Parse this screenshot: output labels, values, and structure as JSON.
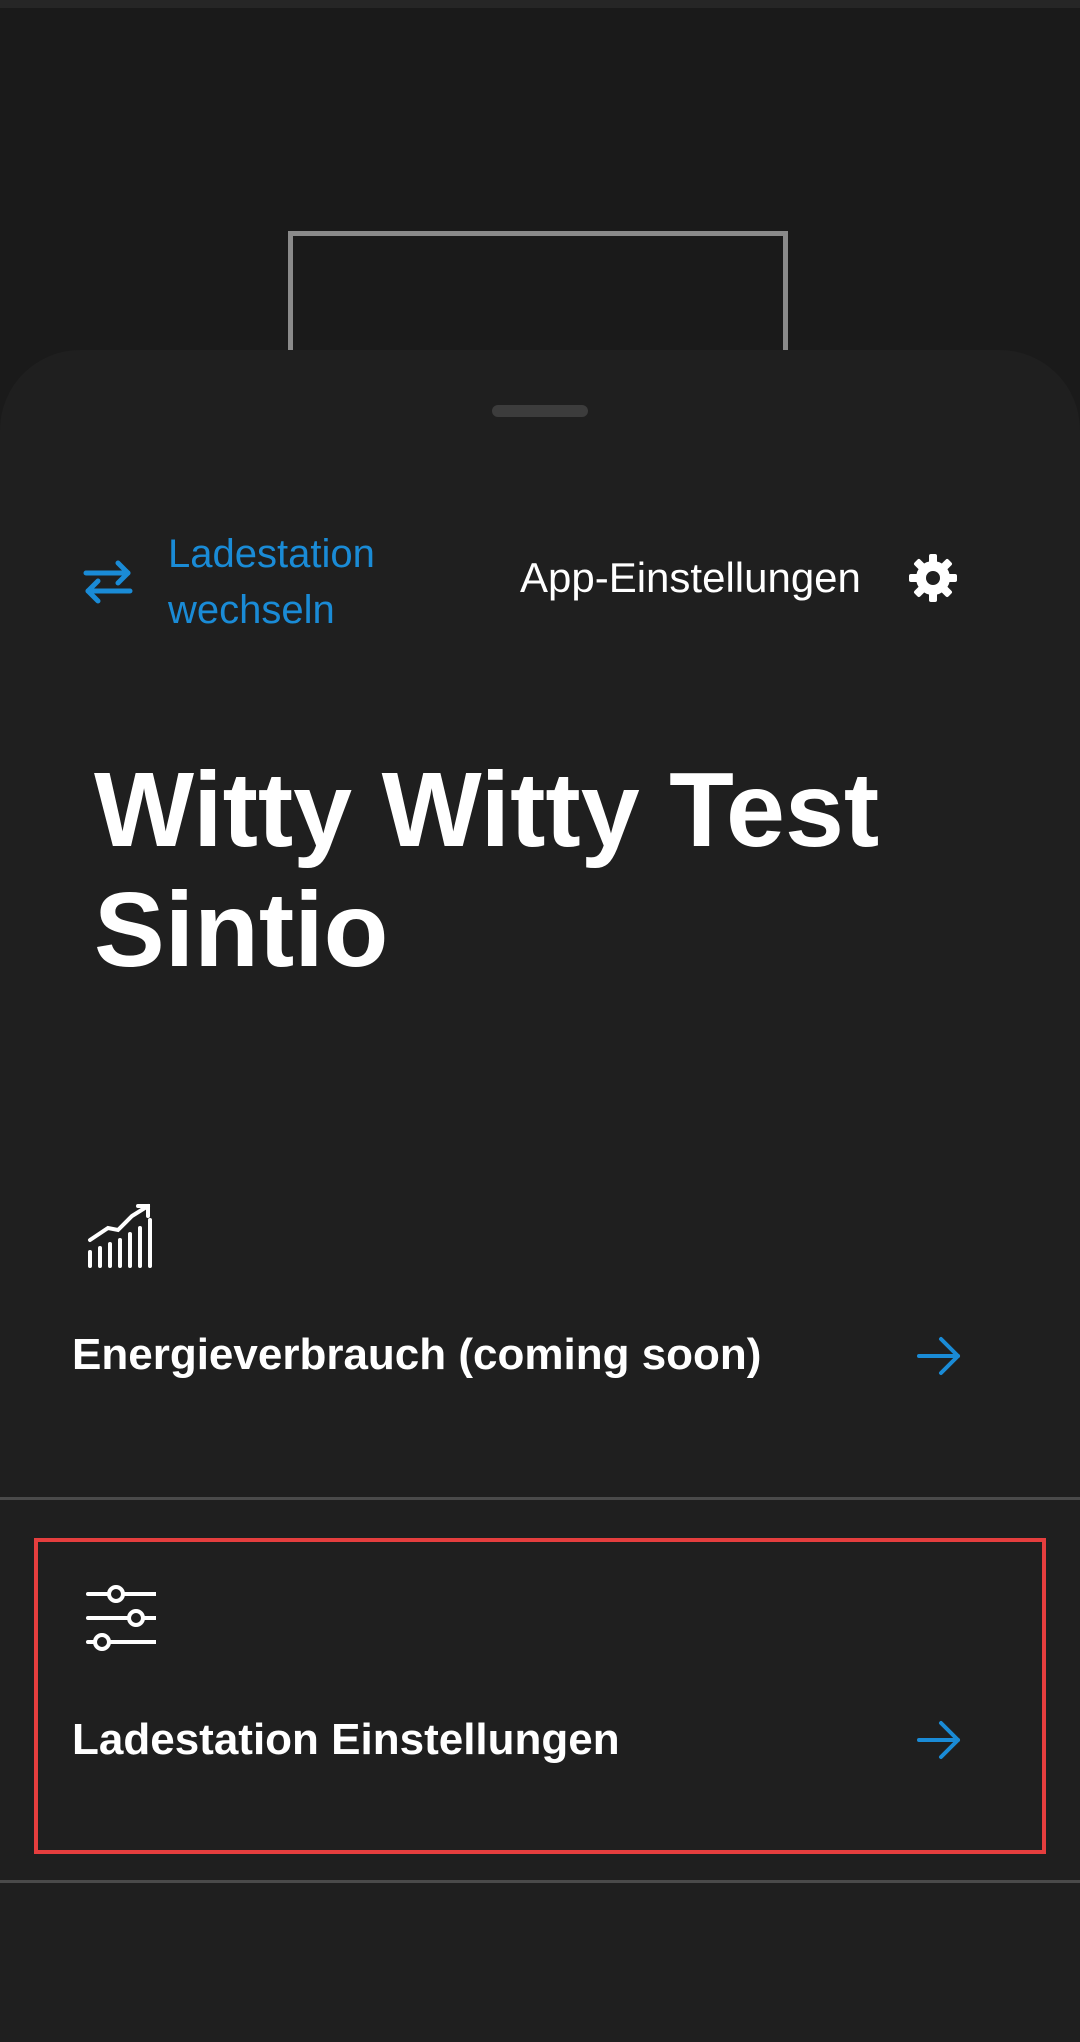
{
  "header": {
    "switch_station_label": "Ladestation wechseln",
    "app_settings_label": "App-Einstellungen"
  },
  "station": {
    "name": "Witty Witty Test Sintio"
  },
  "menu": {
    "items": [
      {
        "label": "Energieverbrauch (coming soon)",
        "icon": "chart-growth-icon"
      },
      {
        "label": "Ladestation Einstellungen",
        "icon": "sliders-icon"
      }
    ]
  },
  "colors": {
    "background": "#1a1a1a",
    "sheet": "#1f1f1f",
    "accent": "#1a8bd6",
    "text": "#ffffff",
    "highlight": "#e53e3e",
    "divider": "#4a4a4a"
  },
  "icons": {
    "switch": "switch-arrows-icon",
    "settings": "gear-icon",
    "arrow": "arrow-right-icon"
  }
}
